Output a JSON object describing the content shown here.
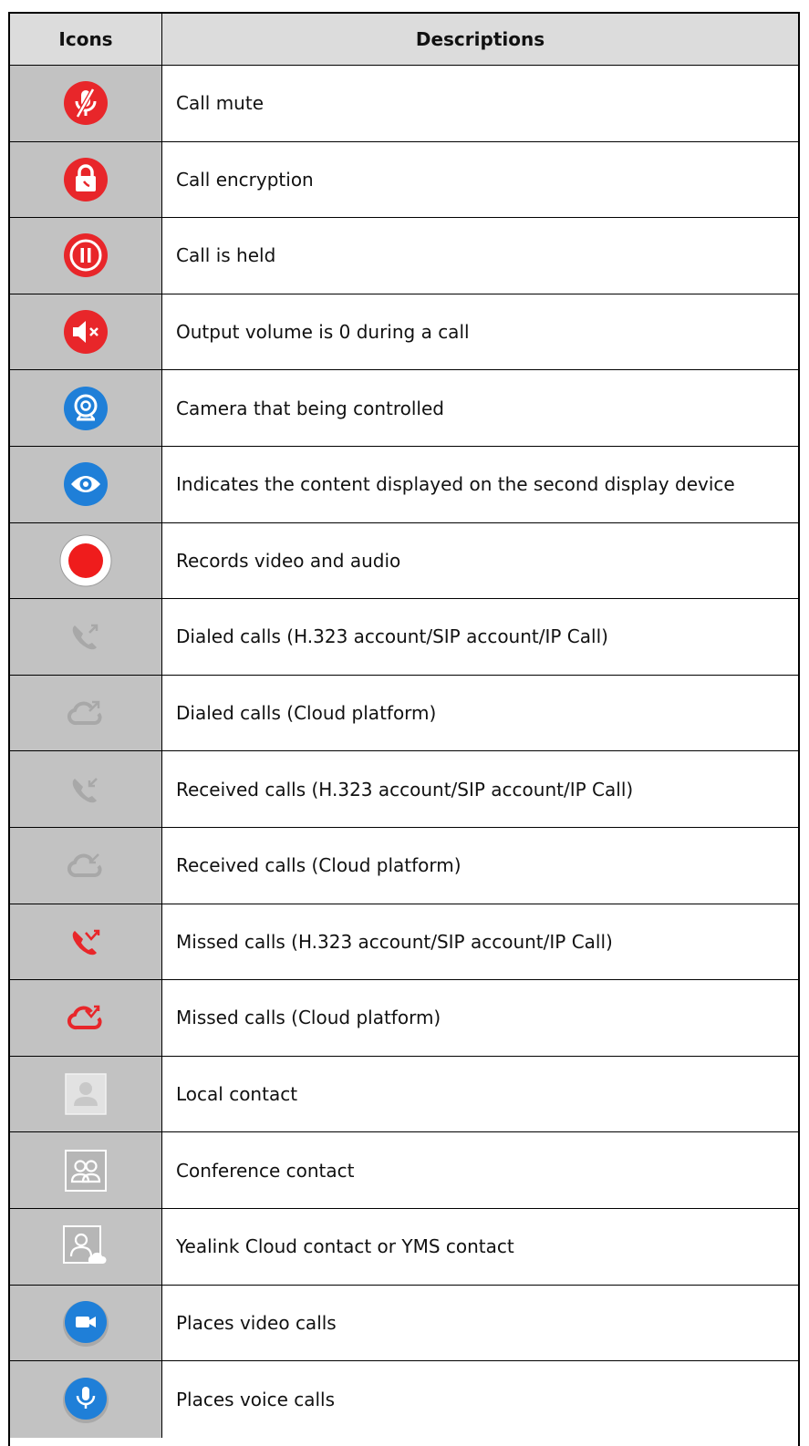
{
  "header": {
    "icons_label": "Icons",
    "descriptions_label": "Descriptions"
  },
  "rows": [
    {
      "icon": "mute-icon",
      "description": "Call mute"
    },
    {
      "icon": "lock-icon",
      "description": "Call encryption"
    },
    {
      "icon": "pause-icon",
      "description": "Call is held"
    },
    {
      "icon": "volume-off-icon",
      "description": "Output volume is 0 during a call"
    },
    {
      "icon": "camera-icon",
      "description": "Camera that being controlled"
    },
    {
      "icon": "eye-icon",
      "description": "Indicates the content displayed on the second display device"
    },
    {
      "icon": "record-icon",
      "description": "Records video and audio"
    },
    {
      "icon": "dialed-call-icon",
      "description": "Dialed calls (H.323 account/SIP account/IP Call)"
    },
    {
      "icon": "dialed-cloud-icon",
      "description": "Dialed calls (Cloud platform)"
    },
    {
      "icon": "received-call-icon",
      "description": "Received calls (H.323 account/SIP account/IP Call)"
    },
    {
      "icon": "received-cloud-icon",
      "description": "Received calls (Cloud platform)"
    },
    {
      "icon": "missed-call-icon",
      "description": "Missed calls (H.323 account/SIP account/IP Call)"
    },
    {
      "icon": "missed-cloud-icon",
      "description": "Missed calls (Cloud platform)"
    },
    {
      "icon": "local-contact-icon",
      "description": "Local contact"
    },
    {
      "icon": "conference-contact-icon",
      "description": "Conference contact"
    },
    {
      "icon": "cloud-contact-icon",
      "description": "Yealink Cloud contact or YMS contact"
    },
    {
      "icon": "video-call-icon",
      "description": "Places video calls"
    },
    {
      "icon": "voice-call-icon",
      "description": "Places voice calls"
    }
  ],
  "colors": {
    "red": "#e8262a",
    "blue": "#1f7fd8",
    "gray_icon": "#a8a8a8",
    "icon_cell": "#c2c2c2",
    "header_bg": "#dcdcdc"
  }
}
